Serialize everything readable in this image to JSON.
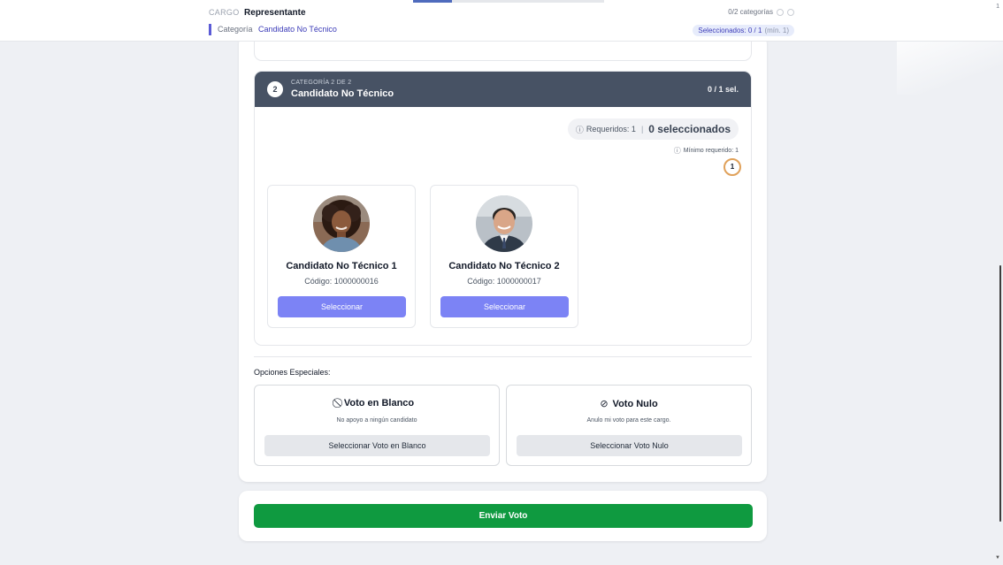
{
  "header": {
    "cargo_label": "CARGO",
    "cargo_value": "Representante",
    "categoria_label": "Categoría",
    "categoria_value": "Candidato No Técnico",
    "categories_progress": "0/2 categorías",
    "selected_label": "Seleccionados: 0 / 1",
    "selected_min": "(mín. 1)",
    "edge_mark": "1"
  },
  "category": {
    "number": "2",
    "subtitle": "CATEGORÍA 2 DE 2",
    "title": "Candidato No Técnico",
    "count": "0 / 1 sel.",
    "required_label": "Requeridos: 1",
    "selected_text": "0 seleccionados",
    "min_required_label": "Mínimo requerido: 1",
    "min_badge": "1"
  },
  "candidates": [
    {
      "name": "Candidato No Técnico 1",
      "code": "Código: 1000000016",
      "button": "Seleccionar",
      "avatar": "woman-avatar"
    },
    {
      "name": "Candidato No Técnico 2",
      "code": "Código: 1000000017",
      "button": "Seleccionar",
      "avatar": "man-avatar"
    }
  ],
  "special": {
    "title": "Opciones Especiales:",
    "blank": {
      "title": "Voto en Blanco",
      "desc": "No apoyo a ningún candidato",
      "button": "Seleccionar Voto en Blanco",
      "icon": "ban-icon"
    },
    "null": {
      "title": "Voto Nulo",
      "desc": "Anulo mi voto para este cargo.",
      "button": "Seleccionar Voto Nulo",
      "icon": "check-circle-icon"
    }
  },
  "submit": {
    "label": "Enviar Voto"
  },
  "colors": {
    "header_dark": "#475264",
    "select_button": "#7c83f5",
    "submit_button": "#0f9a40",
    "accent": "#5b5bd6"
  }
}
